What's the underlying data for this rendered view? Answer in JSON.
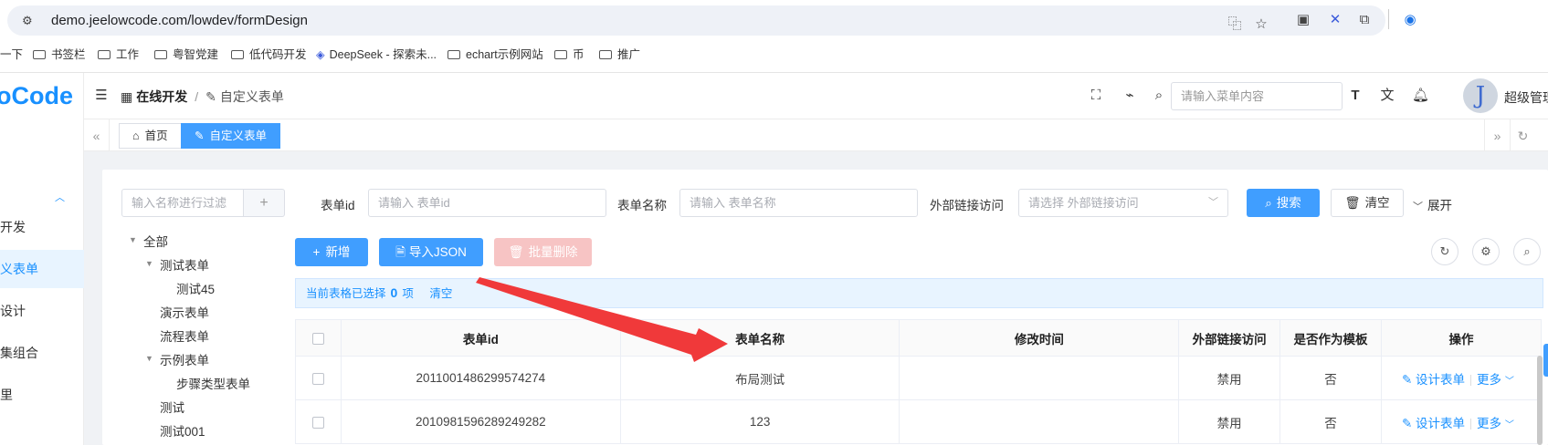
{
  "browser": {
    "url": "demo.jeelowcode.com/lowdev/formDesign",
    "bookmarks": [
      {
        "label": "一下",
        "folder": false
      },
      {
        "label": "书签栏",
        "folder": true
      },
      {
        "label": "工作",
        "folder": true
      },
      {
        "label": "粤智党建",
        "folder": true
      },
      {
        "label": "低代码开发",
        "folder": true
      },
      {
        "label": "DeepSeek - 探索未...",
        "folder": false
      },
      {
        "label": "echart示例网站",
        "folder": true
      },
      {
        "label": "币",
        "folder": true
      },
      {
        "label": "推广",
        "folder": true
      }
    ]
  },
  "sidebar": {
    "logo": "oCode",
    "items": [
      {
        "label": "开发",
        "active": false
      },
      {
        "label": "义表单",
        "active": true
      },
      {
        "label": "设计",
        "active": false
      },
      {
        "label": "集组合",
        "active": false
      },
      {
        "label": "里",
        "active": false
      }
    ]
  },
  "header": {
    "breadcrumb": {
      "root": "在线开发",
      "current": "自定义表单"
    },
    "menu_search_placeholder": "请输入菜单内容",
    "avatar_letter": "J",
    "username": "超级管理"
  },
  "tabs": [
    {
      "label": "首页",
      "active": false
    },
    {
      "label": "自定义表单",
      "active": true
    }
  ],
  "tree": {
    "filter_placeholder": "输入名称进行过滤",
    "add_label": "+",
    "nodes": [
      {
        "label": "全部"
      },
      {
        "label": "测试表单"
      },
      {
        "label": "测试45"
      },
      {
        "label": "演示表单"
      },
      {
        "label": "流程表单"
      },
      {
        "label": "示例表单"
      },
      {
        "label": "步骤类型表单"
      },
      {
        "label": "测试"
      },
      {
        "label": "测试001"
      }
    ]
  },
  "search": {
    "form_id_label": "表单id",
    "form_id_placeholder": "请输入 表单id",
    "form_name_label": "表单名称",
    "form_name_placeholder": "请输入 表单名称",
    "external_label": "外部链接访问",
    "external_placeholder": "请选择 外部链接访问",
    "search_button": "搜索",
    "clear_button": "清空",
    "expand_button": "展开"
  },
  "toolbar": {
    "add_button": "新增",
    "import_button": "导入JSON",
    "batch_delete_button": "批量删除"
  },
  "selection": {
    "prefix": "当前表格已选择",
    "count": "0",
    "suffix": "项",
    "clear": "清空"
  },
  "table": {
    "columns": [
      "表单id",
      "表单名称",
      "修改时间",
      "外部链接访问",
      "是否作为模板",
      "操作"
    ],
    "rows": [
      {
        "id": "2011001486299574274",
        "name": "布局测试",
        "modified": "",
        "external": "禁用",
        "template": "否",
        "design": "设计表单",
        "more": "更多"
      },
      {
        "id": "2010981596289249282",
        "name": "123",
        "modified": "",
        "external": "禁用",
        "template": "否",
        "design": "设计表单",
        "more": "更多"
      }
    ]
  },
  "colors": {
    "primary": "#409eff",
    "arrow": "#f0393a",
    "danger_disabled": "#f7c4c4"
  }
}
